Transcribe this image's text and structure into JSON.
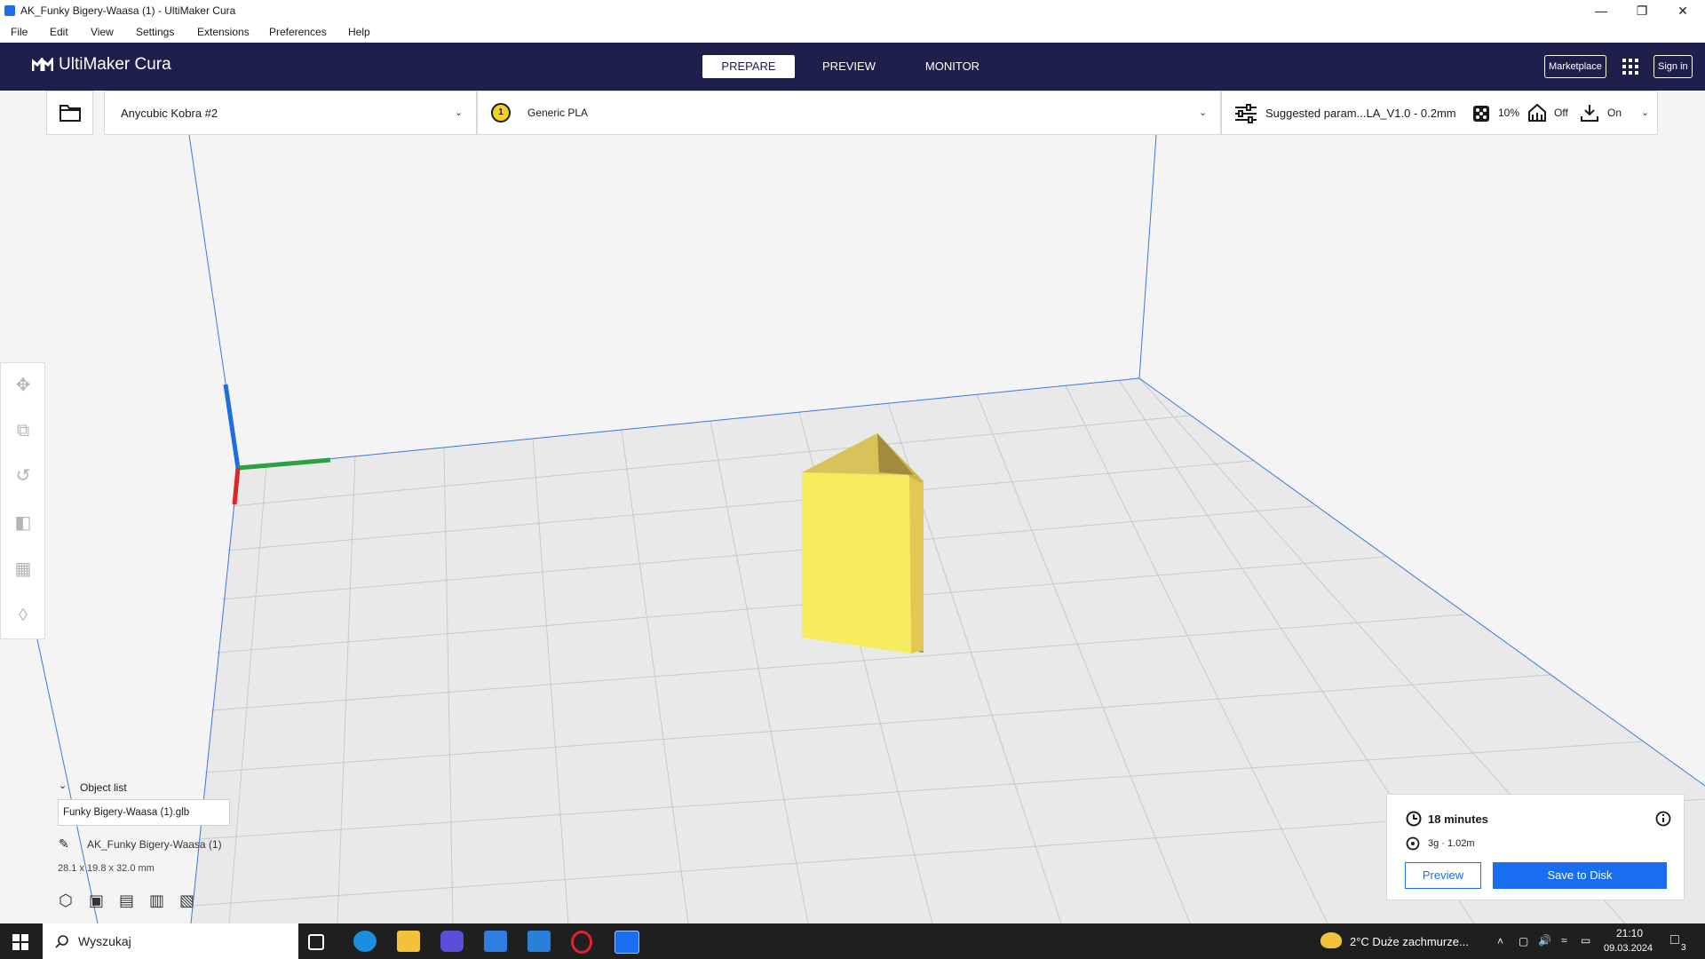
{
  "window": {
    "title": "AK_Funky Bigery-Waasa (1) - UltiMaker Cura",
    "controls": [
      "—",
      "❐",
      "✕"
    ]
  },
  "menu": [
    "File",
    "Edit",
    "View",
    "Settings",
    "Extensions",
    "Preferences",
    "Help"
  ],
  "header": {
    "logo": "UltiMaker Cura",
    "tabs": [
      "PREPARE",
      "PREVIEW",
      "MONITOR"
    ],
    "active_tab": "PREPARE",
    "marketplace": "Marketplace",
    "sign_in": "Sign in"
  },
  "toolbar": {
    "printer": "Anycubic Kobra #2",
    "extruder_number": "1",
    "material": "Generic PLA",
    "profile": "Suggested param...LA_V1.0 - 0.2mm",
    "infill": "10%",
    "support": "Off",
    "adhesion": "On"
  },
  "object_list": {
    "title": "Object list",
    "file": "Funky Bigery-Waasa (1).glb",
    "object_name": "AK_Funky Bigery-Waasa (1)",
    "dimensions": "28.1 x 19.8 x 32.0 mm"
  },
  "print_panel": {
    "time": "18 minutes",
    "material_usage": "3g · 1.02m",
    "preview_button": "Preview",
    "save_button": "Save to Disk"
  },
  "taskbar": {
    "search_placeholder": "Wyszukaj",
    "weather": "2°C  Duże zachmurze...",
    "time": "21:10",
    "date": "09.03.2024",
    "notifications": "3"
  },
  "colors": {
    "header_bg": "#1e1f4a",
    "accent": "#196ef0",
    "model": "#f7e35a"
  }
}
